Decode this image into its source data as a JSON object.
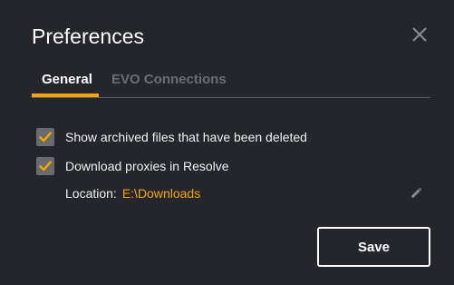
{
  "dialog": {
    "title": "Preferences",
    "close_icon": "close-icon"
  },
  "tabs": [
    {
      "label": "General",
      "active": true
    },
    {
      "label": "EVO Connections",
      "active": false
    }
  ],
  "options": {
    "show_archived": {
      "label": "Show archived files that have been deleted",
      "checked": true
    },
    "download_proxies": {
      "label": "Download proxies in Resolve",
      "checked": true
    }
  },
  "location": {
    "label": "Location:",
    "value": "E:\\Downloads",
    "edit_icon": "pencil-icon"
  },
  "actions": {
    "save_label": "Save"
  },
  "colors": {
    "background": "#24262b",
    "accent": "#f5a700",
    "checkbox": "#6a6b6e",
    "inactive_tab": "#6b6d72"
  }
}
